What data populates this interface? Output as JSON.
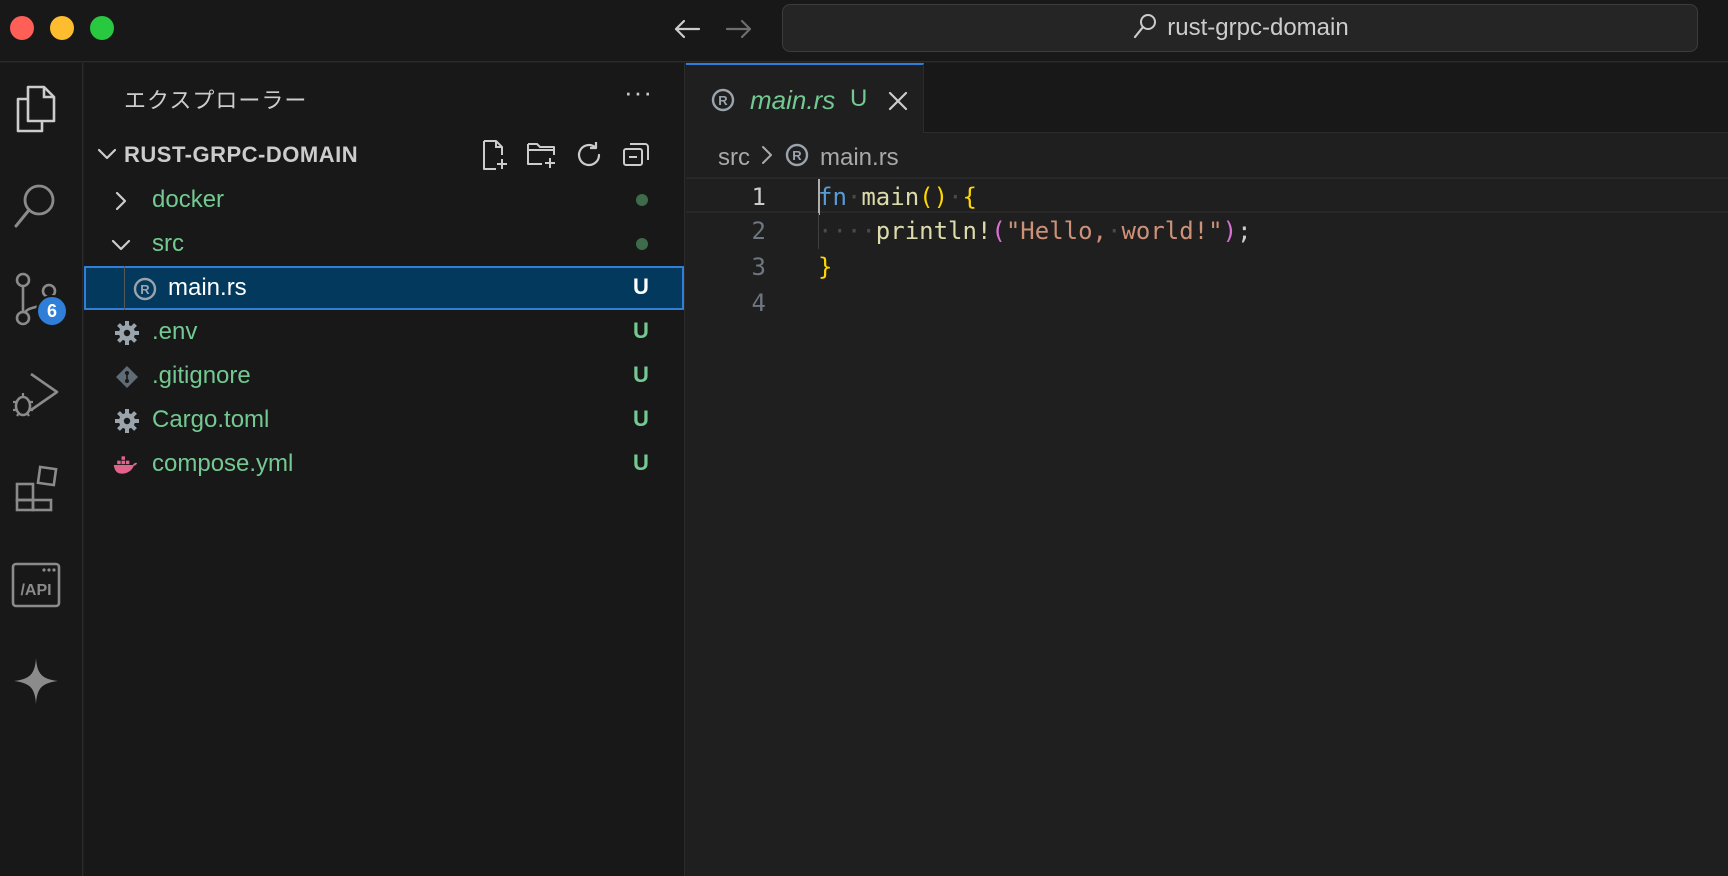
{
  "titlebar": {
    "search_text": "rust-grpc-domain"
  },
  "activitybar": {
    "items": [
      {
        "name": "explorer-icon"
      },
      {
        "name": "search-icon"
      },
      {
        "name": "source-control-icon",
        "badge": "6"
      },
      {
        "name": "run-debug-icon"
      },
      {
        "name": "extensions-icon"
      },
      {
        "name": "api-icon",
        "label": "/API"
      },
      {
        "name": "sparkle-icon"
      }
    ]
  },
  "sidebar": {
    "title": "エクスプローラー",
    "more": "···",
    "folder": {
      "name": "RUST-GRPC-DOMAIN",
      "actions": [
        "new-file-icon",
        "new-folder-icon",
        "refresh-icon",
        "collapse-all-icon"
      ]
    },
    "tree": [
      {
        "label": "docker",
        "type": "folder",
        "expanded": false,
        "status": "dot"
      },
      {
        "label": "src",
        "type": "folder",
        "expanded": true,
        "status": "dot"
      },
      {
        "label": "main.rs",
        "type": "rust-file",
        "status": "U",
        "selected": true
      },
      {
        "label": ".env",
        "type": "gear-file",
        "status": "U"
      },
      {
        "label": ".gitignore",
        "type": "git-file",
        "status": "U"
      },
      {
        "label": "Cargo.toml",
        "type": "gear-file",
        "status": "U"
      },
      {
        "label": "compose.yml",
        "type": "docker-file",
        "status": "U"
      }
    ]
  },
  "editor": {
    "tab": {
      "title": "main.rs",
      "status": "U"
    },
    "breadcrumb": {
      "folder": "src",
      "file": "main.rs"
    },
    "lines": [
      {
        "num": "1",
        "text": "fn main() {"
      },
      {
        "num": "2",
        "text": "    println!(\"Hello, world!\");"
      },
      {
        "num": "3",
        "text": "}"
      },
      {
        "num": "4",
        "text": ""
      }
    ]
  },
  "colors": {
    "accent": "#2f7fd9",
    "untracked": "#73c991",
    "selection": "#04395e"
  }
}
